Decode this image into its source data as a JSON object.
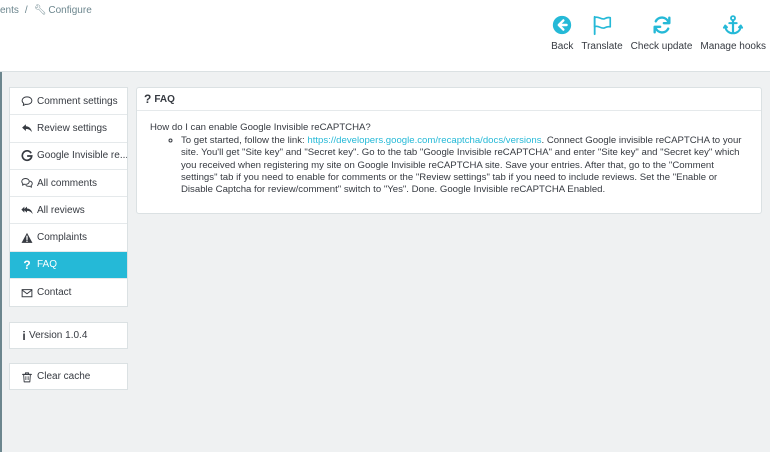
{
  "breadcrumb": {
    "parent": "ents",
    "separator": "/",
    "current": "Configure"
  },
  "toolbar": [
    {
      "label": "Back",
      "icon": "back-arrow-icon"
    },
    {
      "label": "Translate",
      "icon": "flag-icon"
    },
    {
      "label": "Check update",
      "icon": "refresh-icon"
    },
    {
      "label": "Manage hooks",
      "icon": "anchor-icon"
    }
  ],
  "sidebar": {
    "items": [
      {
        "label": "Comment settings",
        "icon": "comment-icon"
      },
      {
        "label": "Review settings",
        "icon": "reply-icon"
      },
      {
        "label": "Google Invisible re...",
        "icon": "google-icon"
      },
      {
        "label": "All comments",
        "icon": "comments-icon"
      },
      {
        "label": "All reviews",
        "icon": "reply-all-icon"
      },
      {
        "label": "Complaints",
        "icon": "warning-icon"
      },
      {
        "label": "FAQ",
        "icon": "question-icon",
        "active": true
      },
      {
        "label": "Contact",
        "icon": "envelope-icon"
      }
    ],
    "version": "Version 1.0.4",
    "clear_cache": "Clear cache"
  },
  "faq": {
    "title": "FAQ",
    "question": "How do I can enable Google Invisible reCAPTCHA?",
    "answer_prefix": "To get started, follow the link: ",
    "answer_link": "https://developers.google.com/recaptcha/docs/versions",
    "answer_suffix": ". Connect Google invisible reCAPTCHA to your site. You'll get \"Site key\" and \"Secret key\". Go to the tab \"Google Invisible reCAPTCHA\" and enter \"Site key\" and \"Secret key\" which you received when registering my site on Google Invisible reCAPTCHA site. Save your entries. After that, go to the \"Comment settings\" tab if you need to enable for comments or the \"Review settings\" tab if you need to include reviews. Set the \"Enable or Disable Captcha for review/comment\" switch to \"Yes\". Done. Google Invisible reCAPTCHA Enabled."
  },
  "colors": {
    "accent": "#25b9d7",
    "text": "#363a41",
    "background": "#eff1f2"
  }
}
